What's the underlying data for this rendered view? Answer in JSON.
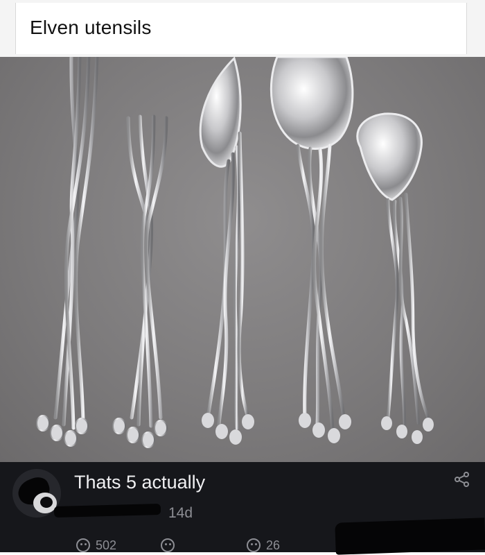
{
  "post": {
    "title": "Elven utensils"
  },
  "comment": {
    "text": "Thats 5 actually",
    "timestamp": "14d",
    "likes_count": "502",
    "replies_count": "26"
  },
  "icons": {
    "share": "share-icon",
    "like": "like-icon",
    "reaction": "smiley-icon",
    "reply": "reply-icon"
  },
  "colors": {
    "comment_bg": "#16171b",
    "muted_text": "#8d8e94",
    "photo_bg": "#7d7b7c"
  }
}
